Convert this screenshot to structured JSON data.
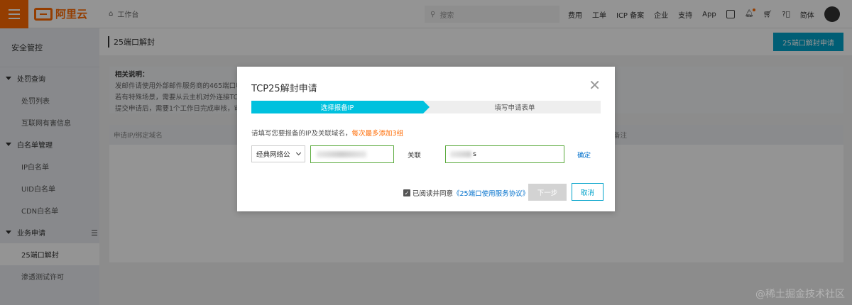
{
  "topbar": {
    "logo_text": "阿里云",
    "workbench_label": "工作台",
    "search_placeholder": "搜索",
    "nav": [
      "费用",
      "工单",
      "ICP 备案",
      "企业",
      "支持",
      "App"
    ],
    "lang": "简体"
  },
  "sidebar": {
    "title": "安全管控",
    "groups": [
      {
        "label": "处罚查询",
        "items": [
          "处罚列表",
          "互联网有害信息"
        ]
      },
      {
        "label": "白名单管理",
        "items": [
          "IP白名单",
          "UID白名单",
          "CDN白名单"
        ]
      },
      {
        "label": "业务申请",
        "items": [
          "25端口解封",
          "渗透测试许可"
        ]
      }
    ],
    "active_item": "25端口解封"
  },
  "main": {
    "title": "25端口解封",
    "apply_button": "25端口解封申请",
    "info_title": "相关说明：",
    "info_lines": [
      "发邮件请使用外部邮件服务商的465端口收",
      "若有特殊场景，需要从云主机对外连接TC",
      "提交申请后，需要1个工作日完成审核，审"
    ],
    "table_header_left": "申请IP/绑定域名",
    "table_header_right": "备注"
  },
  "modal": {
    "title": "TCP25解封申请",
    "close_glyph": "✕",
    "step1": "选择报备IP",
    "step2": "填写申请表单",
    "hint_text": "请填写您要报备的IP及关联域名，",
    "hint_warn": "每次最多添加3组",
    "network_select": "经典网络公",
    "assoc_label": "关联",
    "domain_suffix": "s",
    "confirm": "确定",
    "agree_text": "已阅读并同意",
    "agreement_link": "《25端口使用服务协议》",
    "next_button": "下一步",
    "cancel_button": "取消"
  },
  "watermark": "@稀土掘金技术社区",
  "colors": {
    "brand": "#ff6a00",
    "primary": "#00a2ca",
    "step_active": "#00c1de",
    "link": "#0070cc"
  }
}
